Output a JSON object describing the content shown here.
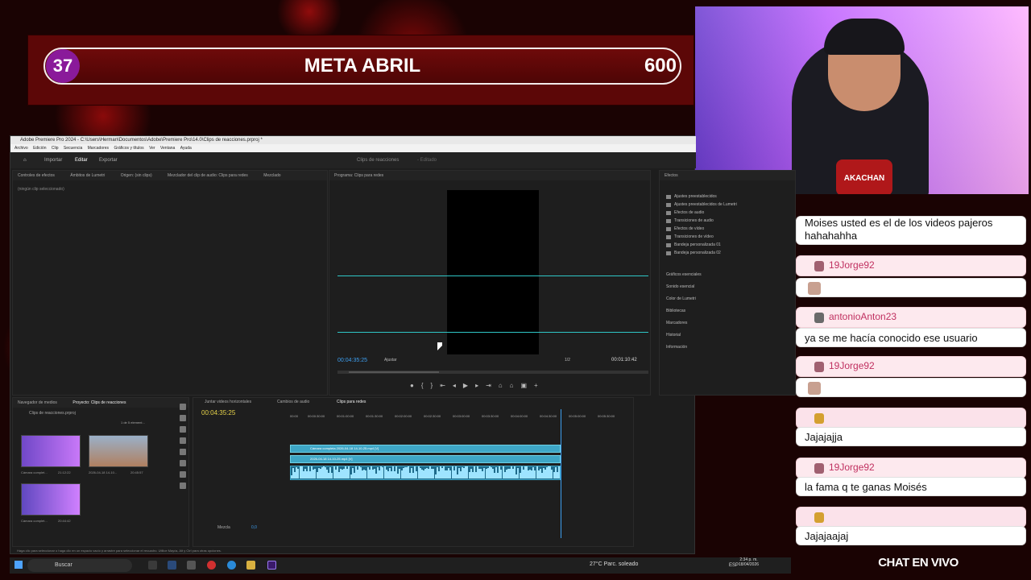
{
  "overlay": {
    "goal": {
      "start": "37",
      "title": "META ABRIL",
      "end": "600"
    },
    "chat_label": "CHAT EN VIVO",
    "cam_badge": "AKACHAN"
  },
  "chat": {
    "messages": [
      {
        "name": "",
        "text": "Moises usted es el de los videos pajeros hahahahha"
      },
      {
        "name": "19Jorge92",
        "text": ""
      },
      {
        "name": "antonioAnton23",
        "text": "ya se me hacía conocido ese usuario"
      },
      {
        "name": "19Jorge92",
        "text": ""
      },
      {
        "name": "",
        "text": "Jajajajja"
      },
      {
        "name": "19Jorge92",
        "text": "la fama q te ganas Moisés"
      },
      {
        "name": "",
        "text": "Jajajaajaj"
      }
    ]
  },
  "premiere": {
    "window_title": "Adobe Premiere Pro 2024 - C:\\Users\\Herman\\Documentos\\Adobe\\Premiere Pro\\14.0\\Clips de reacciones.prproj *",
    "menu": [
      "Archivo",
      "Edición",
      "Clip",
      "Secuencia",
      "Marcadores",
      "Gráficos y títulos",
      "Ver",
      "Ventana",
      "Ayuda"
    ],
    "workspace_tabs": [
      "Importar",
      "Editar",
      "Exportar"
    ],
    "project_name": "Clips de reacciones",
    "project_state": "- Editado",
    "panel_tabs": [
      "Controles de efectos",
      "Ámbitos de Lumetri",
      "Origen: (sin clips)",
      "Mezclador del clip de audio: Clips para redes",
      "Mezclado"
    ],
    "no_clip": "(ningún clip seleccionado)",
    "program_monitor_title": "Programa: Clips para redes",
    "program_timecode": "00:04:35:25",
    "fit_label": "Ajustar",
    "resolution": "1/2",
    "duration": "00:01:10:42",
    "effects": {
      "title": "Efectos",
      "items": [
        "Ajustes preestablecidos",
        "Ajustes preestablecidos de Lumetri",
        "Efectos de audio",
        "Transiciones de audio",
        "Efectos de vídeo",
        "Transiciones de vídeo",
        "Bandeja personalizada 01",
        "Bandeja personalizada 02"
      ],
      "panels": [
        "Gráficos esenciales",
        "Sonido esencial",
        "Color de Lumetri",
        "Bibliotecas",
        "Marcadores",
        "Historial",
        "Información"
      ]
    },
    "project_panel": {
      "tabs": [
        "Navegador de medios",
        "Proyecto: Clips de reacciones"
      ],
      "file": "Clips de reacciones.prproj",
      "count": "1 de 5 element...",
      "items": [
        {
          "name": "Cámara complet...",
          "duration": "21:12:22"
        },
        {
          "name": "2026-04-18 14-10...",
          "duration": "20:45:57"
        },
        {
          "name": "Cámara complet...",
          "duration": "20:44:42"
        }
      ]
    },
    "timeline": {
      "tabs": [
        "Juntar videos horizontales",
        "Cambios de audio",
        "Clips para redes"
      ],
      "timecode": "00:04:35:25",
      "ruler": [
        "00:00",
        "00:00:30:00",
        "00:01:00:00",
        "00:01:30:00",
        "00:02:00:00",
        "00:02:30:00",
        "00:03:00:00",
        "00:03:30:00",
        "00:04:00:00",
        "00:04:30:00",
        "00:05:00:00",
        "00:05:30:00"
      ],
      "clip1": "Cámara completa 2026-04-18 14-10-25.mp4 [V]",
      "clip2": "2026-04-18 14-10-25.mp4 [V]",
      "mix_label": "Mezcla",
      "mix_value": "0,0"
    },
    "status": "Haga clic para seleccionar o haga clic en un espacio vacío y arrastre para seleccionar el recuadro. Utilice Mayús, Alt y Ctrl para otras opciones."
  },
  "taskbar": {
    "search": "Buscar",
    "weather": "27°C  Parc. soleado",
    "lang": "ESP",
    "time": "2:34 p. m.",
    "date": "18/04/2026"
  }
}
